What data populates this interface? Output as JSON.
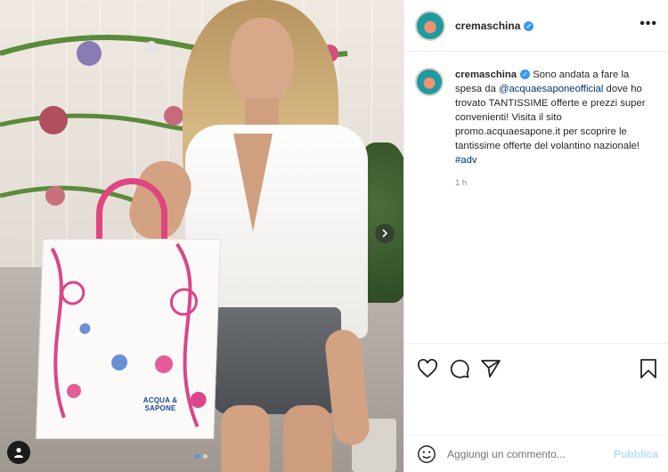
{
  "post": {
    "username": "cremaschina",
    "caption": {
      "text_1": "Sono andata a fare la spesa da ",
      "mention": "@acquaesaponeofficial",
      "text_2": " dove ho trovato TANTISSIME offerte e prezzi super convenienti! Visita il sito promo.acquaesapone.it per scoprire le tantissime offerte del volantino nazionale! ",
      "hashtag": "#adv"
    },
    "timestamp": "1 h",
    "photo": {
      "bag_label": "ACQUA & SAPONE",
      "carousel": {
        "total": 2,
        "active": 1
      }
    }
  },
  "comment_box": {
    "placeholder": "Aggiungi un commento...",
    "publish_label": "Pubblica"
  },
  "icons": {
    "header_more": "more-options-icon",
    "verified": "verified-badge-icon",
    "like": "heart-icon",
    "comment": "comment-icon",
    "share": "paper-plane-icon",
    "save": "bookmark-icon",
    "emoji": "emoji-icon",
    "next": "chevron-right-icon",
    "tags": "user-tag-icon"
  },
  "colors": {
    "verified": "#3897f0",
    "link": "#00376b",
    "publish_disabled": "#b2dffc",
    "carousel_active_dot": "#3d97e6"
  }
}
